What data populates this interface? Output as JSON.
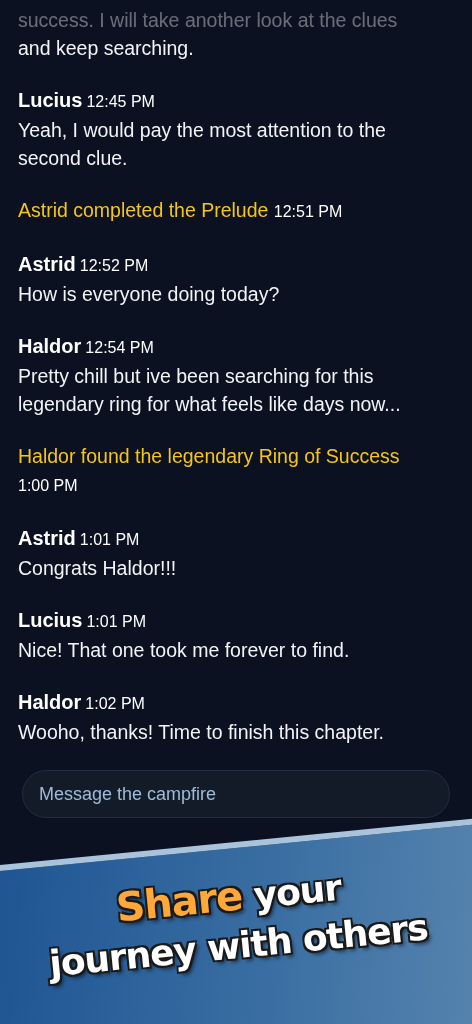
{
  "chat": {
    "items": [
      {
        "kind": "message",
        "faded_top": true,
        "text": "success. I will take another look at the clues and keep searching."
      },
      {
        "kind": "message",
        "author": "Lucius",
        "time": "12:45 PM",
        "text": "Yeah, I would pay the most attention to the second clue."
      },
      {
        "kind": "event",
        "text": "Astrid completed the Prelude",
        "time": "12:51 PM"
      },
      {
        "kind": "message",
        "author": "Astrid",
        "time": "12:52 PM",
        "text": "How is everyone doing today?"
      },
      {
        "kind": "message",
        "author": "Haldor",
        "time": "12:54 PM",
        "text": "Pretty chill but ive been searching for this legendary ring for what feels like days now..."
      },
      {
        "kind": "event",
        "text": "Haldor found the legendary Ring of Success",
        "time": "1:00 PM"
      },
      {
        "kind": "message",
        "author": "Astrid",
        "time": "1:01 PM",
        "text": "Congrats Haldor!!!"
      },
      {
        "kind": "message",
        "author": "Lucius",
        "time": "1:01 PM",
        "text": "Nice! That one took me forever to find."
      },
      {
        "kind": "message",
        "author": "Haldor",
        "time": "1:02 PM",
        "text": "Wooho, thanks! Time to finish this chapter."
      }
    ]
  },
  "composer": {
    "placeholder": "Message the campfire"
  },
  "banner": {
    "lines": [
      {
        "words": [
          {
            "text": "Share",
            "highlight": true
          },
          {
            "text": "your",
            "highlight": false
          }
        ]
      },
      {
        "words": [
          {
            "text": "journey with others",
            "highlight": false
          }
        ]
      }
    ]
  }
}
